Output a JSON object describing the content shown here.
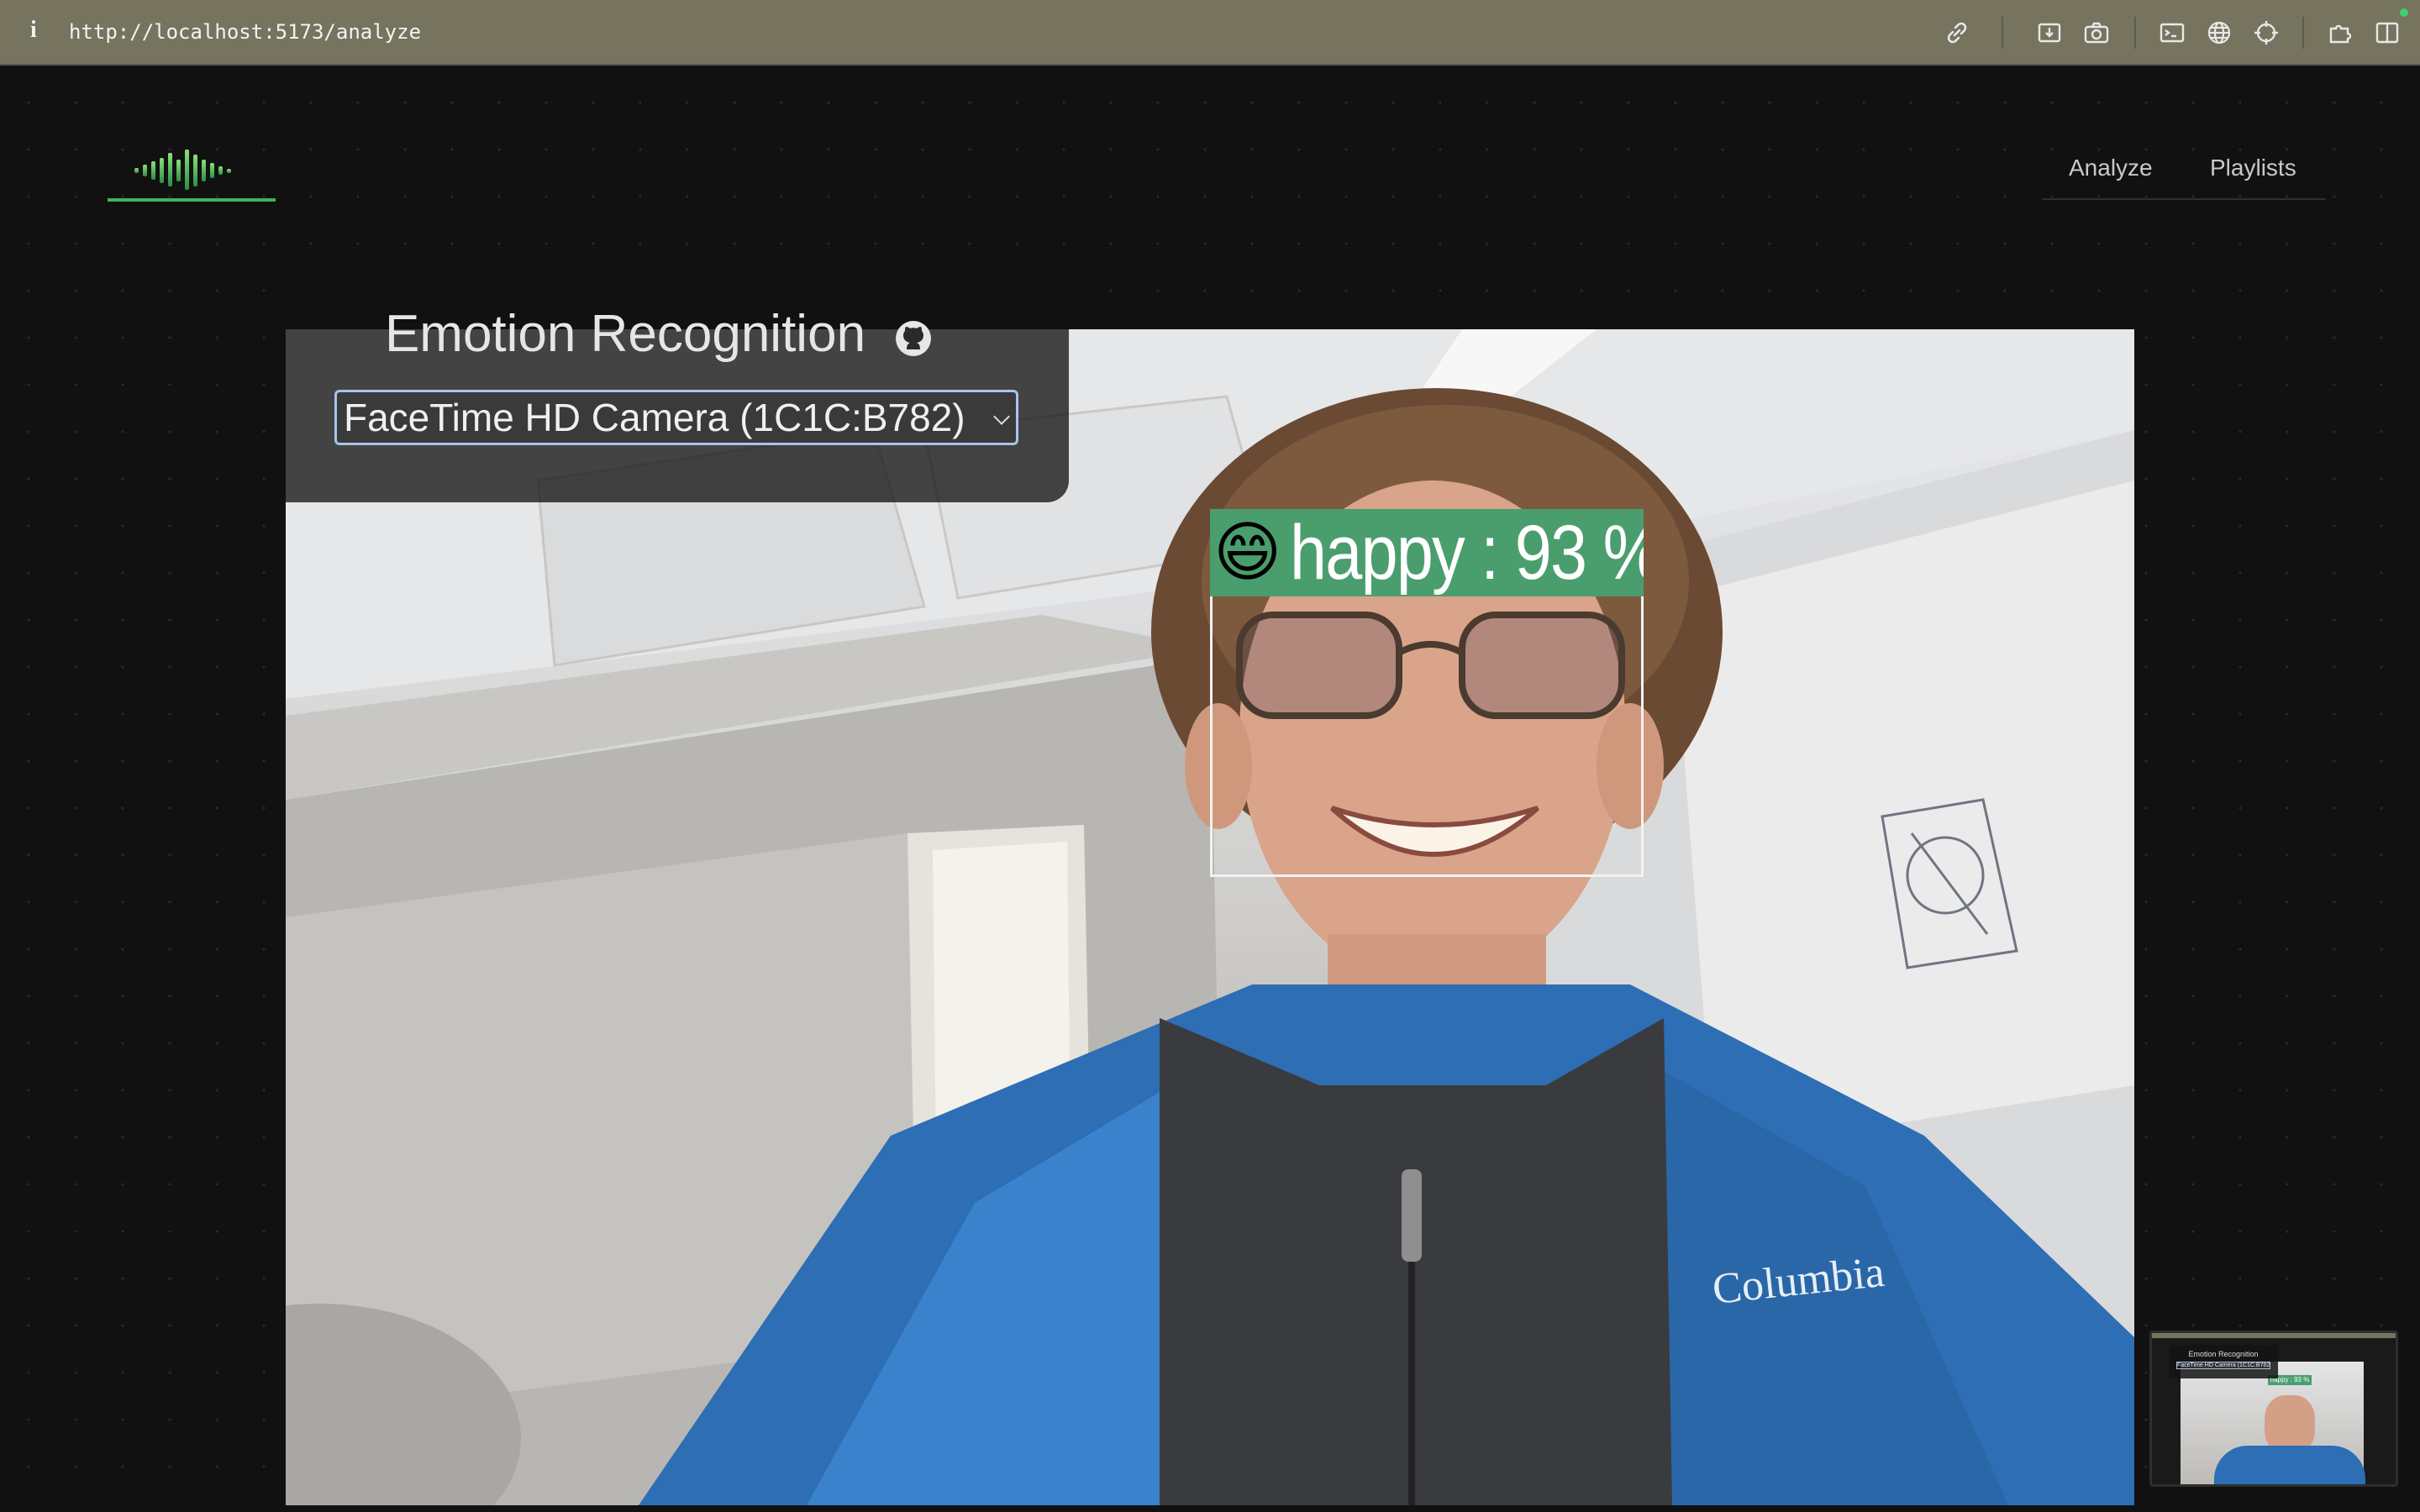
{
  "browser": {
    "info_glyph": "i",
    "url": "http://localhost:5173/analyze",
    "icons": [
      "link-icon",
      "download-icon",
      "camera-icon",
      "terminal-icon",
      "globe-icon",
      "crosshair-icon",
      "extension-icon",
      "split-view-icon"
    ],
    "status_color": "#3fd16a"
  },
  "header": {
    "logo_icon": "sound-wave-logo",
    "accent_color": "#3fb35a",
    "nav": [
      {
        "label": "Analyze"
      },
      {
        "label": "Playlists"
      }
    ]
  },
  "control_panel": {
    "title": "Emotion Recognition",
    "title_icon": "github-icon",
    "camera_select": {
      "selected": "FaceTime HD Camera (1C1C:B782)"
    }
  },
  "detection": {
    "emoji": "😄",
    "label": "happy : 93 %",
    "emotion": "happy",
    "confidence": 93,
    "label_color": "#4a9e6e"
  },
  "preview_thumbnail": {
    "title": "Emotion Recognition",
    "select_text": "FaceTime HD Camera (1C1C:B782)",
    "badge": "happy : 93 %"
  }
}
